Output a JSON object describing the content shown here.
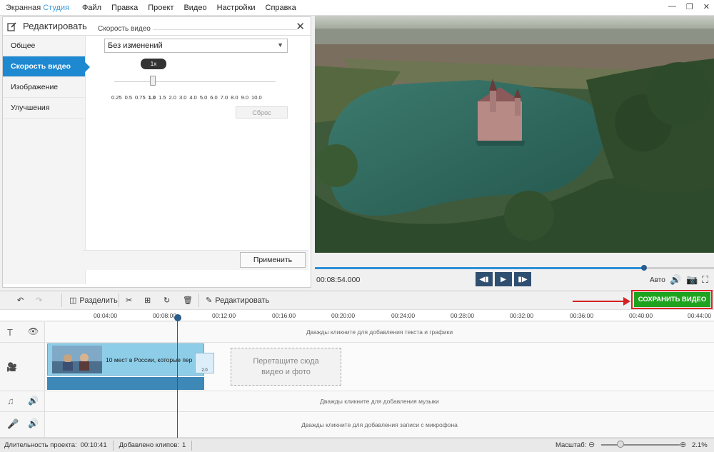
{
  "app": {
    "brand_main": "Экранная ",
    "brand_accent": "Студия"
  },
  "menu": [
    "Файл",
    "Правка",
    "Проект",
    "Видео",
    "Настройки",
    "Справка"
  ],
  "editor": {
    "title": "Редактировать",
    "tabs": [
      "Общее",
      "Скорость видео",
      "Изображение",
      "Улучшения"
    ],
    "active_tab": "Скорость видео",
    "speed_label": "Скорость видео",
    "speed_select": "Без изменений",
    "slider_tooltip": "1x",
    "slider_ticks": [
      "0.25",
      "0.5",
      "0.75",
      "1.0",
      "1.5",
      "2.0",
      "3.0",
      "4.0",
      "5.0",
      "6.0",
      "7.0",
      "8.0",
      "9.0",
      "10.0"
    ],
    "slider_value": "1.0",
    "reset_label": "Сброс",
    "apply_label": "Применить"
  },
  "player": {
    "timecode": "00:08:54.000",
    "progress": 0.825,
    "quality": "Авто"
  },
  "toolbar": {
    "split": "Разделить",
    "edit": "Редактировать",
    "save": "СОХРАНИТЬ ВИДЕО"
  },
  "ruler": [
    "00:04:00",
    "00:08:00",
    "00:12:00",
    "00:16:00",
    "00:20:00",
    "00:24:00",
    "00:28:00",
    "00:32:00",
    "00:36:00",
    "00:40:00",
    "00:44:00"
  ],
  "tracks": {
    "text_hint": "Дважды кликните для добавления текста и графики",
    "clip_title": "10 мест в России, которые пер",
    "transition_label": "2.0",
    "dropzone_line1": "Перетащите сюда",
    "dropzone_line2": "видео и фото",
    "music_hint": "Дважды кликните для добавления музыки",
    "mic_hint": "Дважды кликните для добавления записи с микрофона"
  },
  "status": {
    "duration_label": "Длительность проекта:",
    "duration_value": "00:10:41",
    "clips_label": "Добавлено клипов:",
    "clips_value": "1",
    "zoom_label": "Масштаб:",
    "zoom_value": "2.1%"
  },
  "colors": {
    "accent": "#1e88d0",
    "save": "#1fa31f",
    "annotation": "#d62020"
  }
}
